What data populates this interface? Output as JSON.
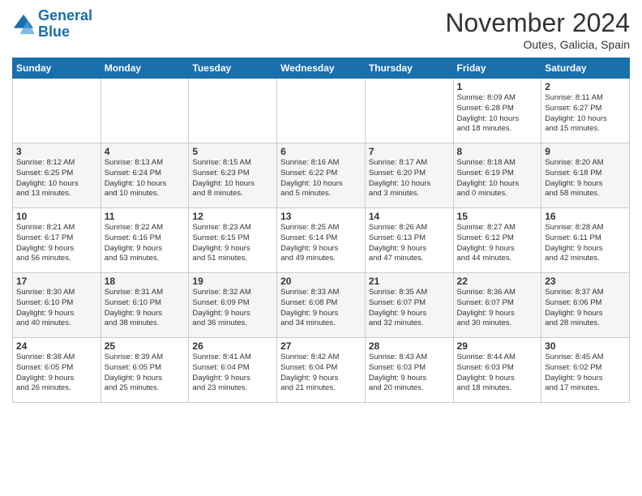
{
  "logo": {
    "line1": "General",
    "line2": "Blue"
  },
  "title": "November 2024",
  "subtitle": "Outes, Galicia, Spain",
  "days_header": [
    "Sunday",
    "Monday",
    "Tuesday",
    "Wednesday",
    "Thursday",
    "Friday",
    "Saturday"
  ],
  "weeks": [
    [
      {
        "day": "",
        "info": ""
      },
      {
        "day": "",
        "info": ""
      },
      {
        "day": "",
        "info": ""
      },
      {
        "day": "",
        "info": ""
      },
      {
        "day": "",
        "info": ""
      },
      {
        "day": "1",
        "info": "Sunrise: 8:09 AM\nSunset: 6:28 PM\nDaylight: 10 hours\nand 18 minutes."
      },
      {
        "day": "2",
        "info": "Sunrise: 8:11 AM\nSunset: 6:27 PM\nDaylight: 10 hours\nand 15 minutes."
      }
    ],
    [
      {
        "day": "3",
        "info": "Sunrise: 8:12 AM\nSunset: 6:25 PM\nDaylight: 10 hours\nand 13 minutes."
      },
      {
        "day": "4",
        "info": "Sunrise: 8:13 AM\nSunset: 6:24 PM\nDaylight: 10 hours\nand 10 minutes."
      },
      {
        "day": "5",
        "info": "Sunrise: 8:15 AM\nSunset: 6:23 PM\nDaylight: 10 hours\nand 8 minutes."
      },
      {
        "day": "6",
        "info": "Sunrise: 8:16 AM\nSunset: 6:22 PM\nDaylight: 10 hours\nand 5 minutes."
      },
      {
        "day": "7",
        "info": "Sunrise: 8:17 AM\nSunset: 6:20 PM\nDaylight: 10 hours\nand 3 minutes."
      },
      {
        "day": "8",
        "info": "Sunrise: 8:18 AM\nSunset: 6:19 PM\nDaylight: 10 hours\nand 0 minutes."
      },
      {
        "day": "9",
        "info": "Sunrise: 8:20 AM\nSunset: 6:18 PM\nDaylight: 9 hours\nand 58 minutes."
      }
    ],
    [
      {
        "day": "10",
        "info": "Sunrise: 8:21 AM\nSunset: 6:17 PM\nDaylight: 9 hours\nand 56 minutes."
      },
      {
        "day": "11",
        "info": "Sunrise: 8:22 AM\nSunset: 6:16 PM\nDaylight: 9 hours\nand 53 minutes."
      },
      {
        "day": "12",
        "info": "Sunrise: 8:23 AM\nSunset: 6:15 PM\nDaylight: 9 hours\nand 51 minutes."
      },
      {
        "day": "13",
        "info": "Sunrise: 8:25 AM\nSunset: 6:14 PM\nDaylight: 9 hours\nand 49 minutes."
      },
      {
        "day": "14",
        "info": "Sunrise: 8:26 AM\nSunset: 6:13 PM\nDaylight: 9 hours\nand 47 minutes."
      },
      {
        "day": "15",
        "info": "Sunrise: 8:27 AM\nSunset: 6:12 PM\nDaylight: 9 hours\nand 44 minutes."
      },
      {
        "day": "16",
        "info": "Sunrise: 8:28 AM\nSunset: 6:11 PM\nDaylight: 9 hours\nand 42 minutes."
      }
    ],
    [
      {
        "day": "17",
        "info": "Sunrise: 8:30 AM\nSunset: 6:10 PM\nDaylight: 9 hours\nand 40 minutes."
      },
      {
        "day": "18",
        "info": "Sunrise: 8:31 AM\nSunset: 6:10 PM\nDaylight: 9 hours\nand 38 minutes."
      },
      {
        "day": "19",
        "info": "Sunrise: 8:32 AM\nSunset: 6:09 PM\nDaylight: 9 hours\nand 36 minutes."
      },
      {
        "day": "20",
        "info": "Sunrise: 8:33 AM\nSunset: 6:08 PM\nDaylight: 9 hours\nand 34 minutes."
      },
      {
        "day": "21",
        "info": "Sunrise: 8:35 AM\nSunset: 6:07 PM\nDaylight: 9 hours\nand 32 minutes."
      },
      {
        "day": "22",
        "info": "Sunrise: 8:36 AM\nSunset: 6:07 PM\nDaylight: 9 hours\nand 30 minutes."
      },
      {
        "day": "23",
        "info": "Sunrise: 8:37 AM\nSunset: 6:06 PM\nDaylight: 9 hours\nand 28 minutes."
      }
    ],
    [
      {
        "day": "24",
        "info": "Sunrise: 8:38 AM\nSunset: 6:05 PM\nDaylight: 9 hours\nand 26 minutes."
      },
      {
        "day": "25",
        "info": "Sunrise: 8:39 AM\nSunset: 6:05 PM\nDaylight: 9 hours\nand 25 minutes."
      },
      {
        "day": "26",
        "info": "Sunrise: 8:41 AM\nSunset: 6:04 PM\nDaylight: 9 hours\nand 23 minutes."
      },
      {
        "day": "27",
        "info": "Sunrise: 8:42 AM\nSunset: 6:04 PM\nDaylight: 9 hours\nand 21 minutes."
      },
      {
        "day": "28",
        "info": "Sunrise: 8:43 AM\nSunset: 6:03 PM\nDaylight: 9 hours\nand 20 minutes."
      },
      {
        "day": "29",
        "info": "Sunrise: 8:44 AM\nSunset: 6:03 PM\nDaylight: 9 hours\nand 18 minutes."
      },
      {
        "day": "30",
        "info": "Sunrise: 8:45 AM\nSunset: 6:02 PM\nDaylight: 9 hours\nand 17 minutes."
      }
    ]
  ]
}
